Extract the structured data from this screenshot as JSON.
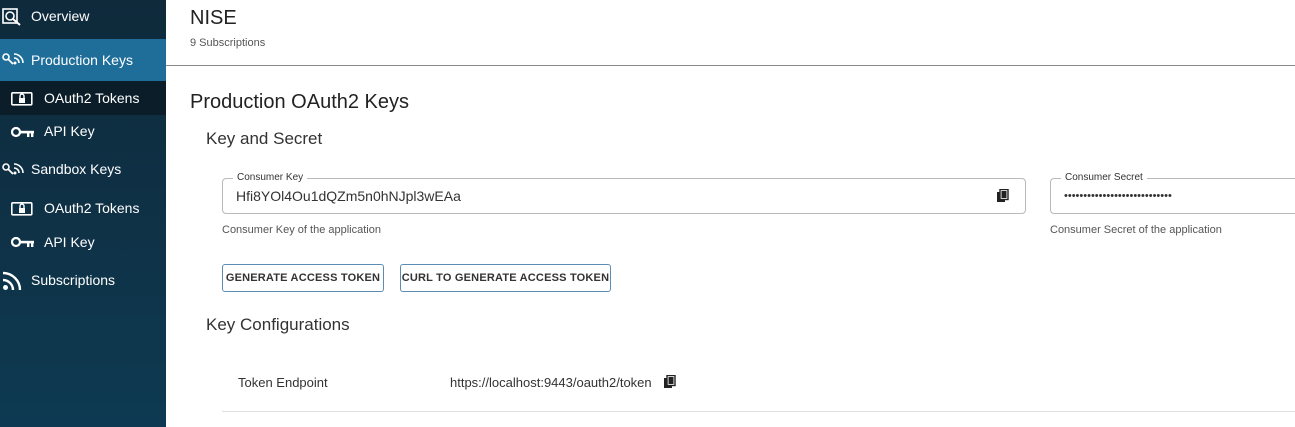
{
  "sidebar": {
    "items": [
      {
        "label": "Overview",
        "icon": "overview-icon"
      },
      {
        "label": "Production Keys",
        "icon": "keys-icon",
        "active": true
      },
      {
        "label": "OAuth2 Tokens",
        "icon": "lock-icon"
      },
      {
        "label": "API Key",
        "icon": "key-icon"
      },
      {
        "label": "Sandbox Keys",
        "icon": "keys-icon"
      },
      {
        "label": "OAuth2 Tokens",
        "icon": "lock-icon"
      },
      {
        "label": "API Key",
        "icon": "key-icon"
      },
      {
        "label": "Subscriptions",
        "icon": "rss-icon"
      }
    ]
  },
  "header": {
    "title": "NISE",
    "subtitle": "9 Subscriptions"
  },
  "main": {
    "title": "Production OAuth2 Keys",
    "key_section": {
      "heading": "Key and Secret",
      "consumer_key": {
        "label": "Consumer Key",
        "value": "Hfi8YOl4Ou1dQZm5n0hNJpl3wEAa",
        "helper": "Consumer Key of the application"
      },
      "consumer_secret": {
        "label": "Consumer Secret",
        "value": "••••••••••••••••••••••••••••",
        "helper": "Consumer Secret of the application"
      },
      "buttons": {
        "generate": "GENERATE ACCESS TOKEN",
        "curl": "CURL TO GENERATE ACCESS TOKEN"
      }
    },
    "config_section": {
      "heading": "Key Configurations",
      "rows": [
        {
          "label": "Token Endpoint",
          "value": "https://localhost:9443/oauth2/token"
        }
      ]
    }
  },
  "colors": {
    "sidebar_bg": "#0f3247",
    "active_bg": "#1f6e9a",
    "button_border": "#5b8db4"
  }
}
